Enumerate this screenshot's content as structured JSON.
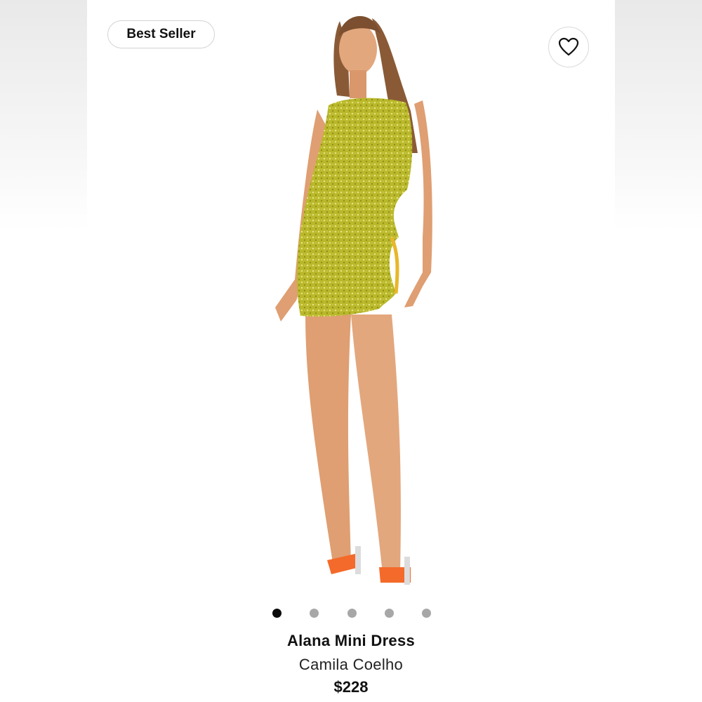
{
  "badge": {
    "label": "Best Seller"
  },
  "favorite": {
    "icon": "heart-icon"
  },
  "gallery": {
    "image": "product-photo",
    "dots": [
      "active",
      "inactive",
      "inactive",
      "inactive",
      "inactive"
    ]
  },
  "product": {
    "name": "Alana Mini Dress",
    "brand": "Camila Coelho",
    "price": "$228"
  },
  "colors": {
    "dress": "#b8b72a",
    "shoes": "#f46a2a",
    "dot_active": "#0b0b0b",
    "dot_inactive": "#a7a7a7"
  }
}
